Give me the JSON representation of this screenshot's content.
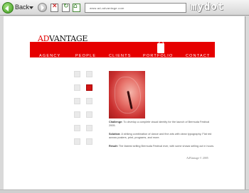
{
  "browser": {
    "back_label": "Back",
    "url": "www.ad-advantage.com",
    "brand": "mydot"
  },
  "site": {
    "logo_prefix": "AD",
    "logo_rest": "VANTAGE",
    "nav": [
      "AGENCY",
      "PEOPLE",
      "CLIENTS",
      "PORTFOLIO",
      "CONTACT"
    ],
    "challenge_label": "Challenge:",
    "challenge_text": "To develop a complete visual identity for the launch of Bermuda Festival 2005.",
    "solution_label": "Solution:",
    "solution_text": "A striking combination of dance and fine arts with clean typography. Flat red across posters, print, programs, and more.",
    "result_label": "Result:",
    "result_text": "The fastest selling Bermuda Festival ever, with some shows selling out in hours.",
    "credit": "AdVantage © 2005"
  },
  "colors": {
    "brand_red": "#e60000",
    "toolbar_gray": "#d6d6d6"
  }
}
